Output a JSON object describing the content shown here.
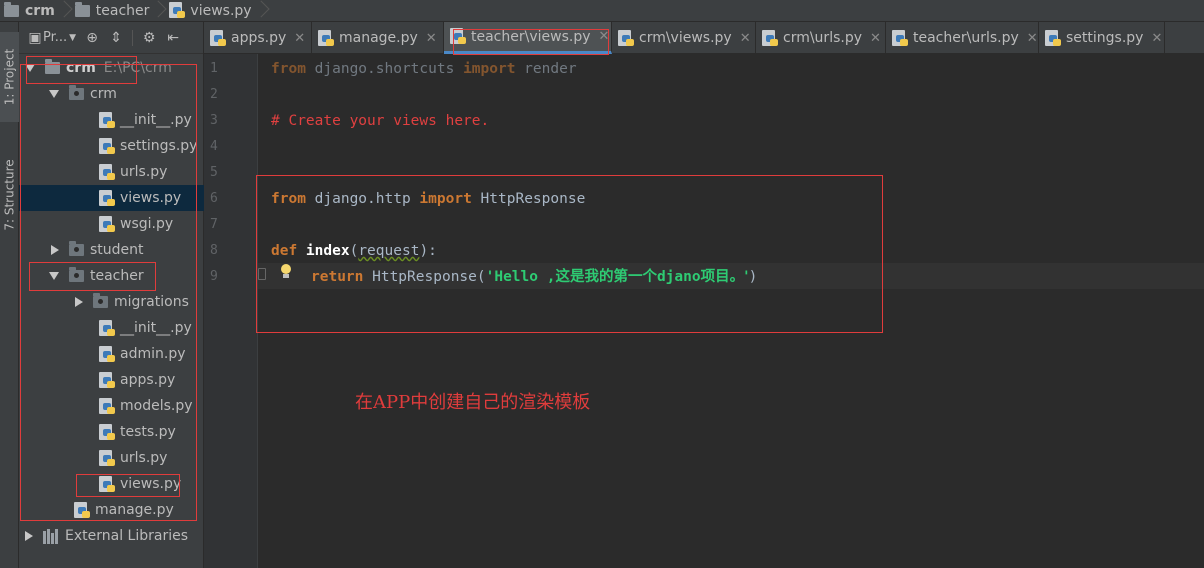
{
  "breadcrumbs": [
    {
      "label": "crm",
      "icon": "folder-icon"
    },
    {
      "label": "teacher",
      "icon": "folder-icon"
    },
    {
      "label": "views.py",
      "icon": "python-file-icon"
    }
  ],
  "tool_strip": {
    "project_tab": "1: Project",
    "structure_tab": "7: Structure"
  },
  "project_panel": {
    "toolbar": {
      "project_view_label": "Pr...",
      "icons": [
        "project-view-icon",
        "locate-icon",
        "collapse-all-icon",
        "settings-gear-icon",
        "hide-panel-icon"
      ]
    },
    "tree": [
      {
        "label": "crm",
        "path": "E:\\PC\\crm",
        "type": "project-root",
        "expanded": true
      },
      {
        "label": "crm",
        "type": "package",
        "expanded": true
      },
      {
        "label": "__init__.py",
        "type": "file"
      },
      {
        "label": "settings.py",
        "type": "file"
      },
      {
        "label": "urls.py",
        "type": "file"
      },
      {
        "label": "views.py",
        "type": "file",
        "selected": true
      },
      {
        "label": "wsgi.py",
        "type": "file"
      },
      {
        "label": "student",
        "type": "package",
        "expanded": false
      },
      {
        "label": "teacher",
        "type": "package",
        "expanded": true
      },
      {
        "label": "migrations",
        "type": "package",
        "expanded": false
      },
      {
        "label": "__init__.py",
        "type": "file"
      },
      {
        "label": "admin.py",
        "type": "file"
      },
      {
        "label": "apps.py",
        "type": "file"
      },
      {
        "label": "models.py",
        "type": "file"
      },
      {
        "label": "tests.py",
        "type": "file"
      },
      {
        "label": "urls.py",
        "type": "file"
      },
      {
        "label": "views.py",
        "type": "file"
      },
      {
        "label": "manage.py",
        "type": "file"
      },
      {
        "label": "External Libraries",
        "type": "libraries",
        "expanded": false
      }
    ]
  },
  "editor_tabs": [
    {
      "label": "apps.py",
      "close": "✕"
    },
    {
      "label": "manage.py",
      "close": "✕"
    },
    {
      "label": "teacher\\views.py",
      "close": "✕",
      "active": true
    },
    {
      "label": "crm\\views.py",
      "close": "✕"
    },
    {
      "label": "crm\\urls.py",
      "close": "✕"
    },
    {
      "label": "teacher\\urls.py",
      "close": "✕"
    },
    {
      "label": "settings.py",
      "close": "✕"
    }
  ],
  "line_numbers": [
    "1",
    "2",
    "3",
    "4",
    "5",
    "6",
    "7",
    "8",
    "9"
  ],
  "code": {
    "line1": {
      "kw1": "from",
      "mod": " django.shortcuts ",
      "kw2": "import",
      "name": " render"
    },
    "line3": {
      "comment": "# Create your views here."
    },
    "line6": {
      "kw1": "from",
      "mod": " django.http ",
      "kw2": "import",
      "name": " HttpResponse"
    },
    "line8": {
      "kw": "def",
      "fn": " index",
      "open": "(",
      "param": "request",
      "close": "):"
    },
    "line9": {
      "kw": "return",
      "call": " HttpResponse(",
      "str_open": "'Hello ,",
      "str_cn": "这是我的第一个",
      "str_mid": "djano",
      "str_end": "项目。'",
      "close": ")"
    }
  },
  "annotation": {
    "note": "在APP中创建自己的渲染模板",
    "color": "#e03c3c"
  }
}
